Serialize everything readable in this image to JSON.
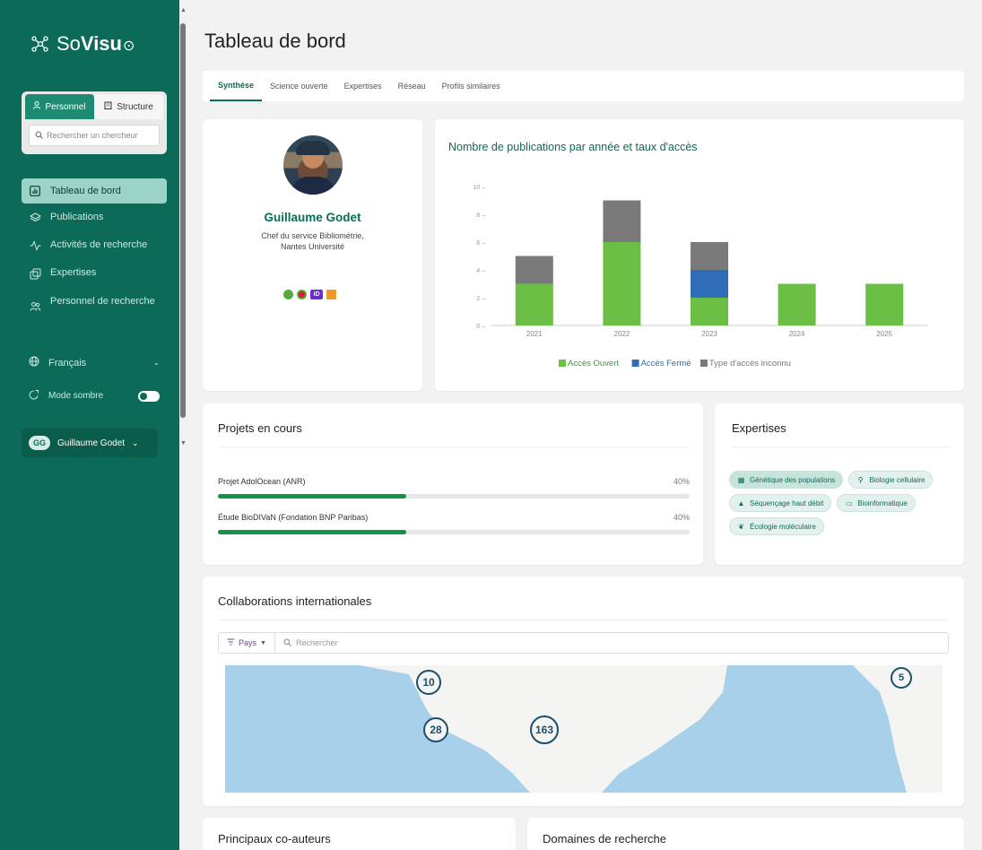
{
  "app": {
    "logo_light": "So",
    "logo_bold": "Visu",
    "logo_end": "⊙",
    "logo_icon": "network-icon"
  },
  "sidebar": {
    "scope_tabs": [
      {
        "label": "Personnel",
        "icon": "person-icon",
        "active": true
      },
      {
        "label": "Structure",
        "icon": "building-icon",
        "active": false
      }
    ],
    "search_placeholder": "Rechercher un chercheur",
    "nav": [
      {
        "label": "Tableau de bord",
        "icon": "dashboard-icon",
        "active": true
      },
      {
        "label": "Publications",
        "icon": "layers-icon"
      },
      {
        "label": "Activités de recherche",
        "icon": "activity-icon"
      },
      {
        "label": "Expertises",
        "icon": "expertise-icon"
      },
      {
        "label": "Personnel de recherche",
        "icon": "people-icon"
      }
    ],
    "language": "Français",
    "dark_mode_label": "Mode sombre",
    "dark_mode_on": true,
    "user_initials": "GG",
    "user_name": "Guillaume Godet"
  },
  "page": {
    "title": "Tableau de bord",
    "tabs": [
      "Synthèse",
      "Science ouverte",
      "Expertises",
      "Réseau",
      "Profils similaires"
    ],
    "active_tab": "Synthèse"
  },
  "profile": {
    "name": "Guillaume Godet",
    "role_line1": "Chef du service Bibliométrie,",
    "role_line2": "Nantes Université",
    "identifiers": [
      "open-access-icon",
      "hal-icon",
      "orcid-icon",
      "scopus-icon"
    ],
    "orcid_text": "iD"
  },
  "chart_data": {
    "type": "bar",
    "title": "Nombre de publications par année et taux d'accès",
    "categories": [
      "2021",
      "2022",
      "2023",
      "2024",
      "2025"
    ],
    "series": [
      {
        "name": "Accès Ouvert",
        "values": [
          3,
          6,
          2,
          3,
          3
        ],
        "color": "#6bbf45"
      },
      {
        "name": "Accès Fermé",
        "values": [
          0,
          0,
          2,
          0,
          0
        ],
        "color": "#2f6db8"
      },
      {
        "name": "Type d'accès inconnu",
        "values": [
          2,
          3,
          2,
          0,
          0
        ],
        "color": "#7a7a7a"
      }
    ],
    "stacked": true,
    "ylim": [
      0,
      10
    ],
    "yticks": [
      "0",
      "2",
      "4",
      "6",
      "8",
      "10"
    ],
    "grid": false,
    "legend": "bottom"
  },
  "projects": {
    "title": "Projets en cours",
    "items": [
      {
        "label": "Projet AdolOcean (ANR)",
        "percent_text": "40%",
        "progress": 0.4
      },
      {
        "label": "Étude BioDIVaN (Fondation BNP Paribas)",
        "percent_text": "40%",
        "progress": 0.4
      }
    ]
  },
  "expertises": {
    "title": "Expertises",
    "chips": [
      {
        "label": "Génétique des populations",
        "icon": "dna-icon",
        "selected": true
      },
      {
        "label": "Biologie cellulaire",
        "icon": "microscope-icon"
      },
      {
        "label": "Séquençage haut débit",
        "icon": "flask-icon"
      },
      {
        "label": "Bioinformatique",
        "icon": "laptop-icon"
      },
      {
        "label": "Écologie moléculaire",
        "icon": "leaf-icon"
      }
    ]
  },
  "collaborations": {
    "title": "Collaborations internationales",
    "filter_label": "Pays",
    "search_placeholder": "Rechercher",
    "clusters": [
      "10",
      "28",
      "163",
      "5"
    ]
  },
  "bottom": {
    "coauthors_title": "Principaux co-auteurs",
    "domains_title": "Domaines de recherche"
  },
  "colors": {
    "sidebar": "#0c6b58",
    "accent": "#0c6b58",
    "progress": "#149245"
  }
}
